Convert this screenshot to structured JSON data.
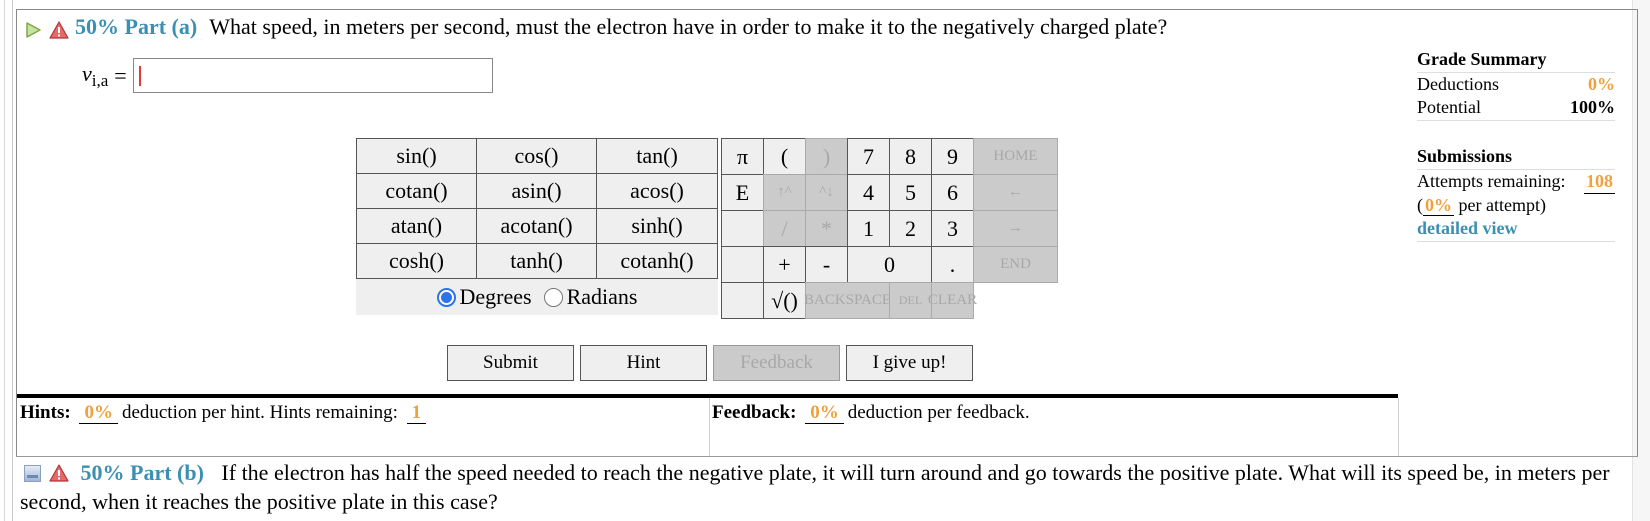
{
  "part_a": {
    "weight": "50%",
    "label": "Part (a)",
    "question": "What speed, in meters per second, must the electron have in order to make it to the negatively charged plate?",
    "variable": "v",
    "variable_sub": "i,a",
    "equals": "=",
    "answer_value": "",
    "icons": [
      "play-arrow-icon",
      "warning-icon"
    ]
  },
  "function_pad": {
    "buttons": [
      "sin()",
      "cos()",
      "tan()",
      "cotan()",
      "asin()",
      "acos()",
      "atan()",
      "acotan()",
      "sinh()",
      "cosh()",
      "tanh()",
      "cotanh()"
    ],
    "mode": {
      "options": [
        "Degrees",
        "Radians"
      ],
      "selected": "Degrees"
    }
  },
  "keypad": {
    "row1": [
      "π",
      "(",
      ")",
      "7",
      "8",
      "9",
      "HOME"
    ],
    "row2": [
      "E",
      "↑^",
      "^↓",
      "4",
      "5",
      "6",
      "←"
    ],
    "row3": [
      "",
      "/",
      "*",
      "1",
      "2",
      "3",
      "→"
    ],
    "row4": [
      "",
      "+",
      "-",
      "0",
      ".",
      "END"
    ],
    "row5": [
      "",
      "√()",
      "BACKSPACE",
      "DEL",
      "CLEAR"
    ]
  },
  "actions": {
    "submit": "Submit",
    "hint": "Hint",
    "feedback": "Feedback",
    "give_up": "I give up!"
  },
  "grade_summary": {
    "title": "Grade Summary",
    "deductions_label": "Deductions",
    "deductions_value": "0%",
    "potential_label": "Potential",
    "potential_value": "100%"
  },
  "submissions": {
    "title": "Submissions",
    "attempts_label": "Attempts remaining:",
    "attempts_value": "108",
    "per_attempt_open": "(",
    "per_attempt_value": "0%",
    "per_attempt_label": "per attempt)",
    "detailed_view": "detailed view"
  },
  "hints": {
    "label": "Hints:",
    "deduction_value": "0%",
    "deduction_text": "deduction per hint. Hints remaining:",
    "remaining": "1"
  },
  "feedback": {
    "label": "Feedback:",
    "deduction_value": "0%",
    "deduction_text": "deduction per feedback."
  },
  "part_b": {
    "weight": "50%",
    "label": "Part (b)",
    "question": "If the electron has half the speed needed to reach the negative plate, it will turn around and go towards the positive plate. What will its speed be, in meters per second, when it reaches the positive plate in this case?",
    "icons": [
      "collapsed-square-icon",
      "warning-icon"
    ]
  },
  "colors": {
    "part_label": "#3b8fb5",
    "orange_value": "#f0a03c",
    "disabled_key": "#cbcbcb",
    "key_bg": "#efefef",
    "radio_selected": "#2f73e8"
  }
}
